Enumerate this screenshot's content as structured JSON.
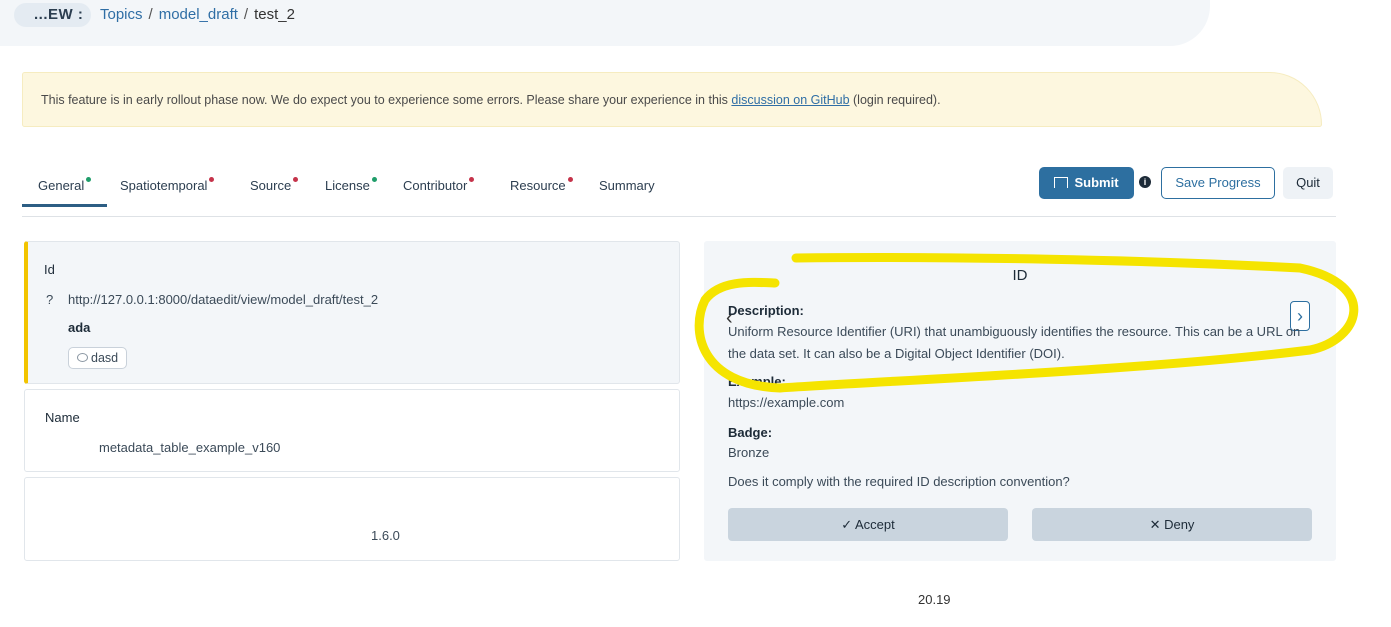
{
  "breadcrumb": {
    "mode_label": "...EW :",
    "trail": [
      "Topics",
      "model_draft"
    ],
    "current": "test_2"
  },
  "alert": {
    "text_before": "This feature is in early rollout phase now. We do expect you to experience some errors. Please share your experience in this ",
    "link_text": "discussion on GitHub",
    "text_after": " (login required)."
  },
  "tabs": [
    {
      "label": "General",
      "status": "green"
    },
    {
      "label": "Spatiotemporal",
      "status": "red"
    },
    {
      "label": "Source",
      "status": "red"
    },
    {
      "label": "License",
      "status": "green"
    },
    {
      "label": "Contributor",
      "status": "red"
    },
    {
      "label": "Resource",
      "status": "red"
    },
    {
      "label": "Summary",
      "status": ""
    }
  ],
  "actions": {
    "submit": "Submit",
    "info": "i",
    "save": "Save Progress",
    "quit": "Quit"
  },
  "fields": {
    "id": {
      "label": "Id",
      "qmark": "?",
      "value": "http://127.0.0.1:8000/dataedit/view/model_draft/test_2",
      "user": "ada",
      "comment": "dasd"
    },
    "name": {
      "label": "Name",
      "value": "metadata_table_example_v160"
    },
    "third": {
      "value": "1.6.0"
    }
  },
  "panel": {
    "title": "ID",
    "description_label": "Description:",
    "description": "Uniform Resource Identifier (URI) that unambiguously identifies the resource. This can be a URL on the data set. It can also be a Digital Object Identifier (DOI).",
    "example_label": "Example:",
    "example": "https://example.com",
    "badge_label": "Badge:",
    "badge": "Bronze",
    "question": "Does it comply with the required ID description convention?",
    "accept": "Accept",
    "deny": "Deny",
    "prev": "‹",
    "next": "›"
  },
  "footer_number": "20.19",
  "colors": {
    "primary": "#2d6fa0",
    "highlight": "#f2c400",
    "status_green": "#1f9d6a",
    "status_red": "#c5334a",
    "annotation": "#f5e400"
  }
}
